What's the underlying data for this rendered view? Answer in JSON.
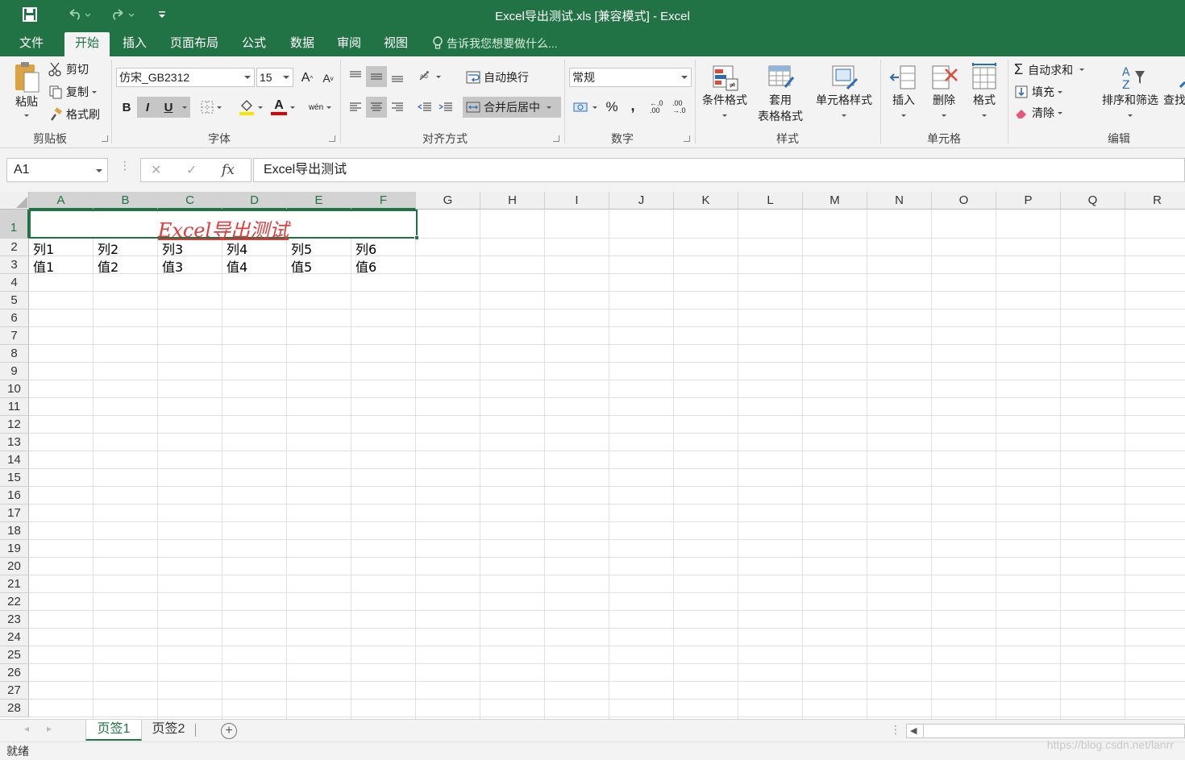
{
  "titlebar": {
    "title": "Excel导出测试.xls  [兼容模式] - Excel",
    "save_icon": "save-icon",
    "undo_icon": "undo-icon",
    "redo_icon": "redo-icon",
    "customize_icon": "customize-quick-access-icon"
  },
  "tabs": [
    "文件",
    "开始",
    "插入",
    "页面布局",
    "公式",
    "数据",
    "审阅",
    "视图"
  ],
  "active_tab": "开始",
  "tell_me": "告诉我您想要做什么...",
  "ribbon": {
    "clipboard": {
      "paste": "粘贴",
      "cut": "剪切",
      "copy": "复制",
      "format_painter": "格式刷",
      "label": "剪贴板"
    },
    "font": {
      "font_name": "仿宋_GB2312",
      "font_size": "15",
      "bold": "B",
      "italic": "I",
      "underline": "U",
      "label": "字体",
      "grow": "A",
      "shrink": "A",
      "font_color_glyph": "A",
      "phonetic": "wén"
    },
    "alignment": {
      "wrap_text": "自动换行",
      "merge_center": "合并后居中",
      "label": "对齐方式"
    },
    "number": {
      "format": "常规",
      "percent": "%",
      "comma": ",",
      "inc_decimal": "←.0 .00",
      "dec_decimal": ".00 →.0",
      "label": "数字"
    },
    "styles": {
      "conditional": "条件格式",
      "table_format_1": "套用",
      "table_format_2": "表格格式",
      "cell_styles": "单元格样式",
      "label": "样式"
    },
    "cells": {
      "insert": "插入",
      "delete": "删除",
      "format": "格式",
      "label": "单元格"
    },
    "editing": {
      "autosum": "自动求和",
      "fill": "填充",
      "clear": "清除",
      "sort_filter": "排序和筛选",
      "find": "查找",
      "label": "编辑"
    }
  },
  "formula_bar": {
    "name_box": "A1",
    "cancel": "✕",
    "enter": "✓",
    "fx": "fx",
    "content": "Excel导出测试"
  },
  "columns": [
    "A",
    "B",
    "C",
    "D",
    "E",
    "F",
    "G",
    "H",
    "I",
    "J",
    "K",
    "L",
    "M",
    "N",
    "O",
    "P",
    "Q",
    "R"
  ],
  "rows": [
    "1",
    "2",
    "3",
    "4",
    "5",
    "6",
    "7",
    "8",
    "9",
    "10",
    "11",
    "12",
    "13",
    "14",
    "15",
    "16",
    "17",
    "18",
    "19",
    "20",
    "21",
    "22",
    "23",
    "24",
    "25",
    "26",
    "27",
    "28"
  ],
  "cells": {
    "merged_title": "Excel导出测试",
    "row2": [
      "列1",
      "列2",
      "列3",
      "列4",
      "列5",
      "列6"
    ],
    "row3": [
      "值1",
      "值2",
      "值3",
      "值4",
      "值5",
      "值6"
    ]
  },
  "sheets": [
    "页签1",
    "页签2"
  ],
  "active_sheet": "页签1",
  "status": "就绪",
  "watermark": "https://blog.csdn.net/lanrr",
  "colors": {
    "accent": "#217346",
    "title_red": "#e03a3a"
  }
}
